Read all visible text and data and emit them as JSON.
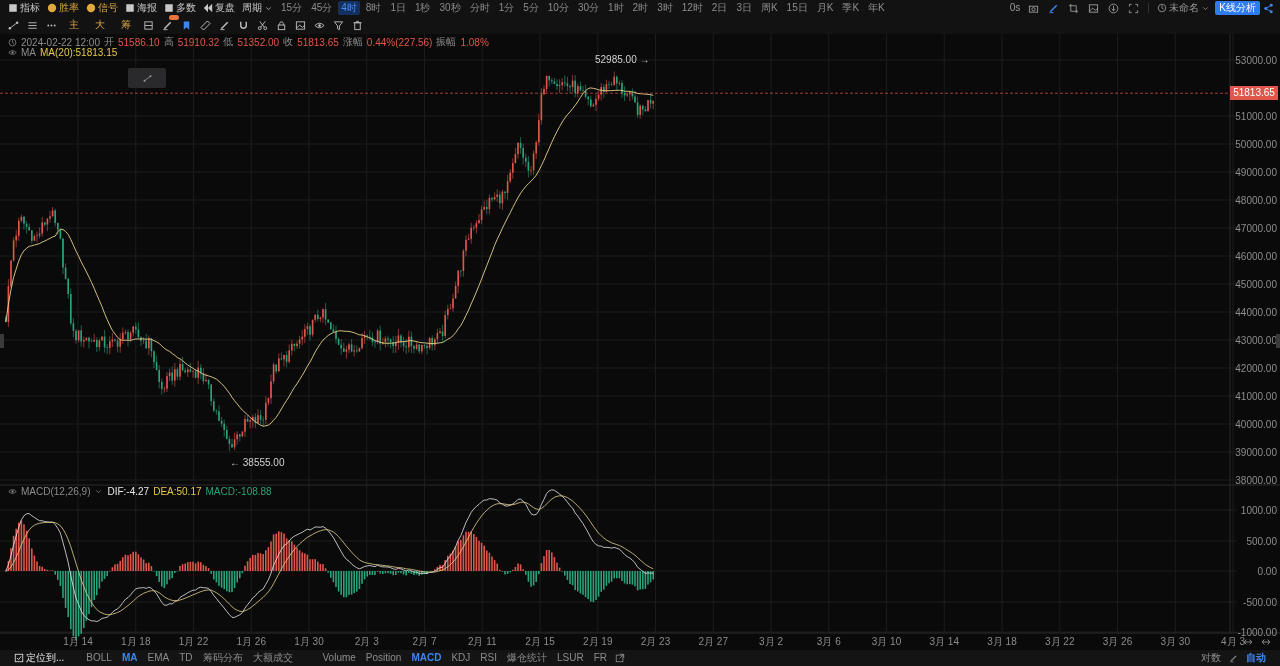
{
  "top_toolbar": {
    "tools": [
      {
        "label": "指标",
        "color": "#c8c8c8"
      },
      {
        "label": "胜率",
        "color": "#e0a93e"
      },
      {
        "label": "信号",
        "color": "#e0a93e"
      },
      {
        "label": "海报",
        "color": "#c8c8c8"
      },
      {
        "label": "多数",
        "color": "#c8c8c8"
      },
      {
        "label": "复盘",
        "color": "#c8c8c8"
      }
    ],
    "period_menu": "周期",
    "intervals": [
      {
        "label": "15分",
        "selected": false
      },
      {
        "label": "45分",
        "selected": false
      },
      {
        "label": "4时",
        "selected": true
      },
      {
        "label": "8时",
        "selected": false
      },
      {
        "label": "1日",
        "selected": false
      },
      {
        "label": "1秒",
        "selected": false
      },
      {
        "label": "30秒",
        "selected": false
      },
      {
        "label": "分时",
        "selected": false
      },
      {
        "label": "1分",
        "selected": false
      },
      {
        "label": "5分",
        "selected": false
      },
      {
        "label": "10分",
        "selected": false
      },
      {
        "label": "30分",
        "selected": false
      },
      {
        "label": "1时",
        "selected": false
      },
      {
        "label": "2时",
        "selected": false
      },
      {
        "label": "3时",
        "selected": false
      },
      {
        "label": "12时",
        "selected": false
      },
      {
        "label": "2日",
        "selected": false
      },
      {
        "label": "3日",
        "selected": false
      },
      {
        "label": "周K",
        "selected": false
      },
      {
        "label": "15日",
        "selected": false
      },
      {
        "label": "月K",
        "selected": false
      },
      {
        "label": "季K",
        "selected": false
      },
      {
        "label": "年K",
        "selected": false
      }
    ],
    "refresh": "0s",
    "layout_name": "未命名",
    "analysis_button": "K线分析"
  },
  "drawing_toolbar": {
    "chart_modes": [
      "主",
      "大",
      "筹"
    ]
  },
  "chart": {
    "legend": {
      "time": "2024-02-22 12:00",
      "fields": [
        {
          "label": "开",
          "value": "51586.10"
        },
        {
          "label": "高",
          "value": "51910.32"
        },
        {
          "label": "低",
          "value": "51352.00"
        },
        {
          "label": "收",
          "value": "51813.65"
        },
        {
          "label": "涨幅",
          "value": "0.44%(227.56)"
        },
        {
          "label": "振幅",
          "value": "1.08%"
        }
      ]
    },
    "ma_legend": {
      "name": "MA",
      "value": "MA(20):51813.15"
    },
    "price_axis": [
      "53000.00",
      "51000.00",
      "50000.00",
      "49000.00",
      "48000.00",
      "47000.00",
      "46000.00",
      "45000.00",
      "44000.00",
      "43000.00",
      "42000.00",
      "41000.00",
      "40000.00",
      "39000.00",
      "38000.00"
    ],
    "last_price": "51813.65",
    "high_marker": "52985.00 →",
    "low_marker": "← 38555.00",
    "macd_legend": {
      "name": "MACD(12,26,9)",
      "dif": "DIF:-4.27",
      "dea": "DEA:50.17",
      "macd": "MACD:-108.88"
    },
    "macd_axis": [
      "1000.00",
      "500.00",
      "0.00",
      "-500.00",
      "-1000.00"
    ],
    "date_axis": [
      "1月 14",
      "1月 18",
      "1月 22",
      "1月 26",
      "1月 30",
      "2月 3",
      "2月 7",
      "2月 11",
      "2月 15",
      "2月 19",
      "2月 23",
      "2月 27",
      "3月 2",
      "3月 6",
      "3月 10",
      "3月 14",
      "3月 18",
      "3月 22",
      "3月 26",
      "3月 30",
      "4月 3"
    ]
  },
  "bottom_bar": {
    "locate": "定位到...",
    "main_indicators": [
      {
        "label": "BOLL",
        "selected": false
      },
      {
        "label": "MA",
        "selected": true
      },
      {
        "label": "EMA",
        "selected": false
      },
      {
        "label": "TD",
        "selected": false
      },
      {
        "label": "筹码分布",
        "selected": false
      },
      {
        "label": "大额成交",
        "selected": false
      }
    ],
    "sub_indicators": [
      {
        "label": "Volume",
        "selected": false
      },
      {
        "label": "Position",
        "selected": false
      },
      {
        "label": "MACD",
        "selected": true
      },
      {
        "label": "KDJ",
        "selected": false
      },
      {
        "label": "RSI",
        "selected": false
      },
      {
        "label": "爆仓统计",
        "selected": false
      },
      {
        "label": "LSUR",
        "selected": false
      },
      {
        "label": "FR",
        "selected": false
      }
    ],
    "scale_options": [
      {
        "label": "对数",
        "selected": false
      },
      {
        "label": "自动",
        "selected": true
      }
    ]
  }
}
